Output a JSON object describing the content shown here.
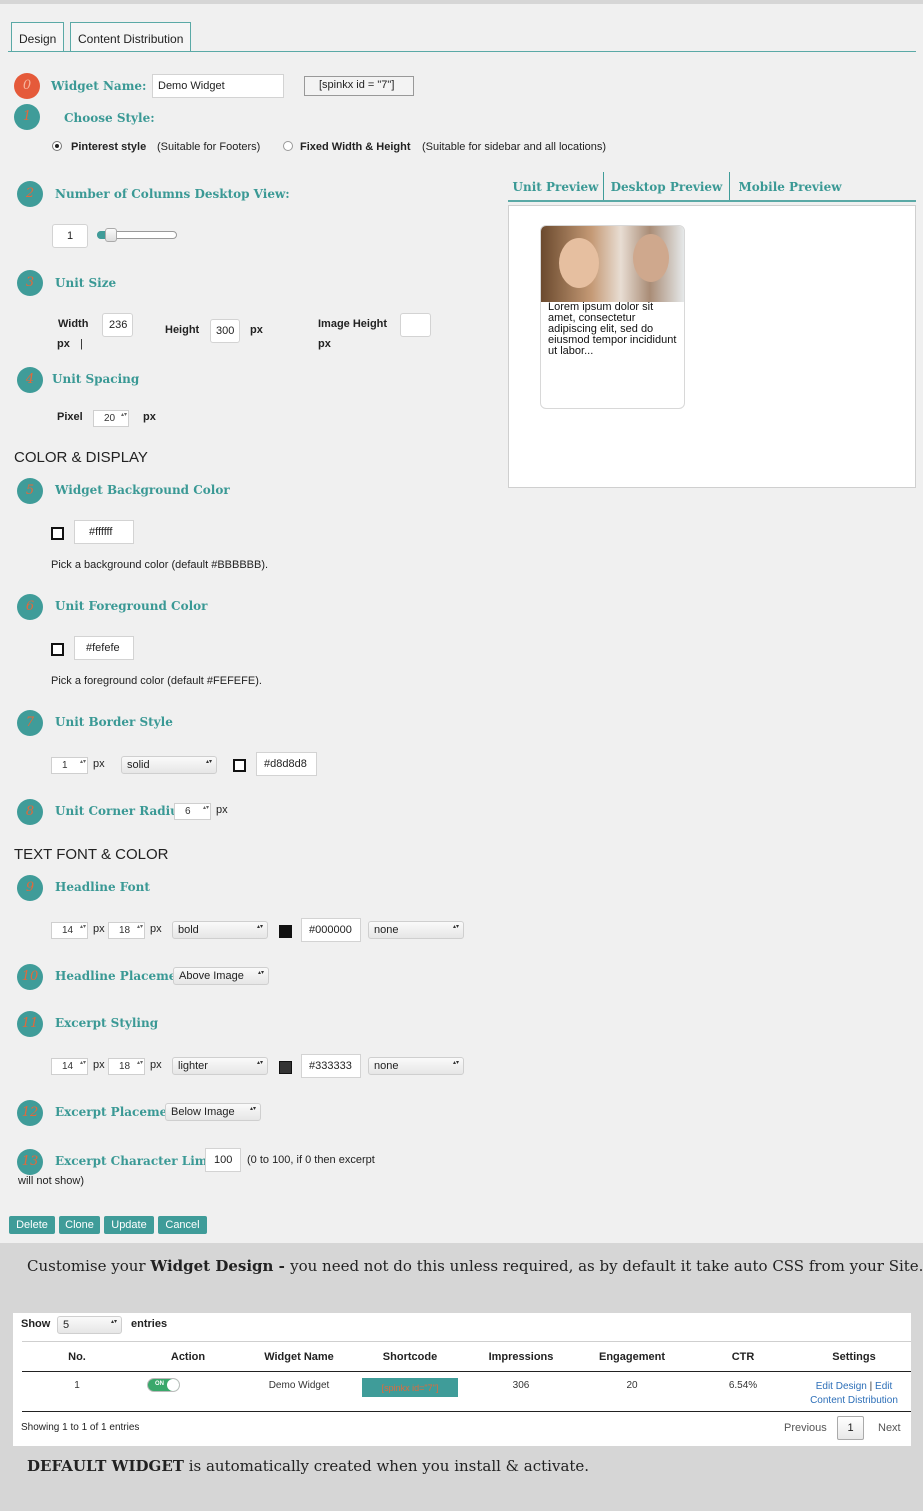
{
  "tabs": [
    "Design",
    "Content Distribution"
  ],
  "widget_name": {
    "num": "0",
    "label": "Widget Name:",
    "value": "Demo Widget",
    "shortcode": "[spinkx id = \"7\"]"
  },
  "choose_style": {
    "num": "1",
    "label": "Choose Style:",
    "opt1_bold": "Pinterest style",
    "opt1_note": "(Suitable for Footers)",
    "opt2_bold": "Fixed Width & Height",
    "opt2_note": "(Suitable for sidebar and all locations)"
  },
  "columns": {
    "num": "2",
    "label": "Number of Columns Desktop View:",
    "value": "1"
  },
  "unit_size": {
    "num": "3",
    "label": "Unit Size",
    "width_label": "Width",
    "width_value": "236",
    "px": "px",
    "height_label": "Height",
    "height_value": "300",
    "image_height_label": "Image Height",
    "cursor": "|"
  },
  "unit_spacing": {
    "num": "4",
    "label": "Unit Spacing",
    "pixel_label": "Pixel",
    "value": "20",
    "px": "px"
  },
  "section_color": "COLOR & DISPLAY",
  "bg_color": {
    "num": "5",
    "label": "Widget Background Color",
    "value": "#ffffff",
    "help": "Pick a background color (default #BBBBBB)."
  },
  "fg_color": {
    "num": "6",
    "label": "Unit Foreground Color",
    "value": "#fefefe",
    "help": "Pick a foreground color (default #FEFEFE)."
  },
  "border_style": {
    "num": "7",
    "label": "Unit Border Style",
    "width": "1",
    "px": "px",
    "style": "solid",
    "color": "#d8d8d8"
  },
  "corner_radius": {
    "num": "8",
    "label": "Unit Corner Radius",
    "value": "6",
    "px": "px"
  },
  "section_font": "TEXT FONT & COLOR",
  "headline_font": {
    "num": "9",
    "label": "Headline Font",
    "size": "14",
    "line": "18",
    "px": "px",
    "weight": "bold",
    "color": "#000000",
    "transform": "none"
  },
  "headline_placement": {
    "num": "10",
    "label": "Headline Placement",
    "value": "Above Image"
  },
  "excerpt_styling": {
    "num": "11",
    "label": "Excerpt Styling",
    "size": "14",
    "line": "18",
    "px": "px",
    "weight": "lighter",
    "color": "#333333",
    "transform": "none"
  },
  "excerpt_placement": {
    "num": "12",
    "label": "Excerpt Placement",
    "value": "Below Image"
  },
  "excerpt_limit": {
    "num": "13",
    "label": "Excerpt Character Limit",
    "value": "100",
    "note": "(0 to 100, if 0 then excerpt",
    "note2": "will not show)"
  },
  "buttons": {
    "delete": "Delete",
    "clone": "Clone",
    "update": "Update",
    "cancel": "Cancel"
  },
  "preview": {
    "tabs": [
      "Unit Preview",
      "Desktop Preview",
      "Mobile Preview"
    ],
    "card_text": "Lorem ipsum dolor sit amet, consectetur adipiscing elit, sed do eiusmod tempor incididunt ut labor..."
  },
  "caption1": {
    "pre": "Customise your ",
    "bold": "Widget Design - ",
    "post": "you need not do this unless required, as by default it take auto CSS from your Site."
  },
  "table": {
    "show_label": "Show",
    "show_value": "5",
    "entries_label": "entries",
    "headers": [
      "No.",
      "Action",
      "Widget Name",
      "Shortcode",
      "Impressions",
      "Engagement",
      "CTR",
      "Settings"
    ],
    "row": {
      "no": "1",
      "toggle": "ON",
      "name": "Demo Widget",
      "shortcode": "[spinkx id=\"7\"]",
      "impressions": "306",
      "engagement": "20",
      "ctr": "6.54%",
      "edit_design": "Edit Design",
      "sep": "|",
      "edit": "Edit",
      "content_dist": "Content Distribution"
    },
    "showing": "Showing 1 to 1 of 1 entries",
    "prev": "Previous",
    "page": "1",
    "next": "Next"
  },
  "caption2": {
    "bold": "DEFAULT WIDGET",
    "post": " is automatically created when you install & activate."
  },
  "colors": {
    "accent": "#3f9c99",
    "badge_red": "#e55a3a",
    "label_teal": "#3a9995"
  }
}
